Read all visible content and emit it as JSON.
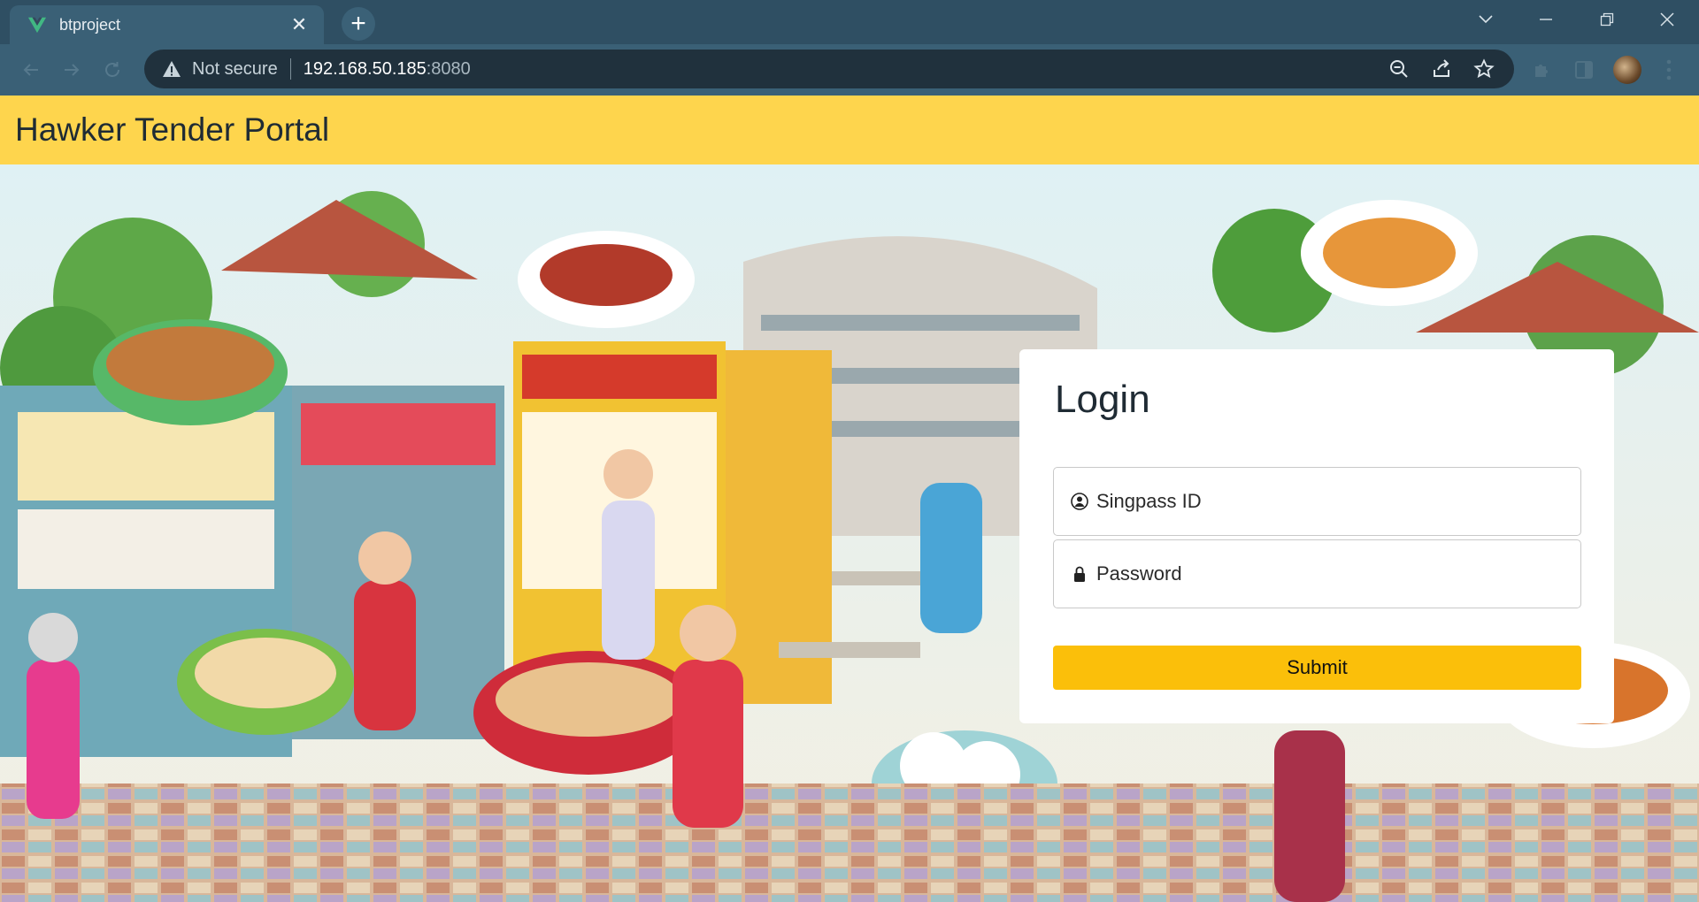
{
  "browser": {
    "tab_title": "btproject",
    "not_secure": "Not secure",
    "url_host": "192.168.50.185",
    "url_port": ":8080"
  },
  "app": {
    "title": "Hawker Tender Portal"
  },
  "login": {
    "heading": "Login",
    "singpass_placeholder": "Singpass ID",
    "password_placeholder": "Password",
    "submit_label": "Submit"
  },
  "colors": {
    "header_bg": "#fed54d",
    "submit_bg": "#fbbf0a",
    "tabbar_bg": "#2f4f63",
    "toolbar_bg": "#3a6076"
  }
}
